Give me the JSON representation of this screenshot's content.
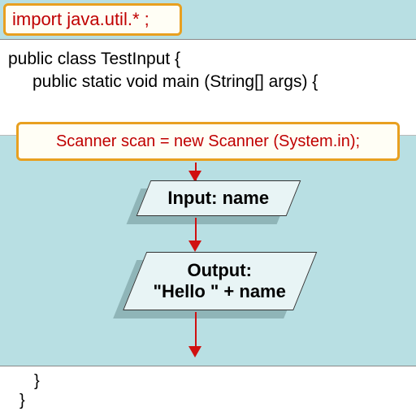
{
  "import_statement": "import java.util.* ;",
  "code": {
    "class_decl": "public class TestInput {",
    "main_decl": "public static void main (String[] args) {",
    "close_main": "}",
    "close_class": "}"
  },
  "scanner_line": "Scanner scan = new Scanner (System.in);",
  "flow": {
    "input": {
      "label": "Input:",
      "var": "name"
    },
    "output": {
      "label": "Output:",
      "expr": "\"Hello \" + name"
    }
  },
  "colors": {
    "highlight_border": "#e8a020",
    "highlight_text": "#c00000",
    "background": "#b8dfe3",
    "arrow": "#d01010"
  }
}
